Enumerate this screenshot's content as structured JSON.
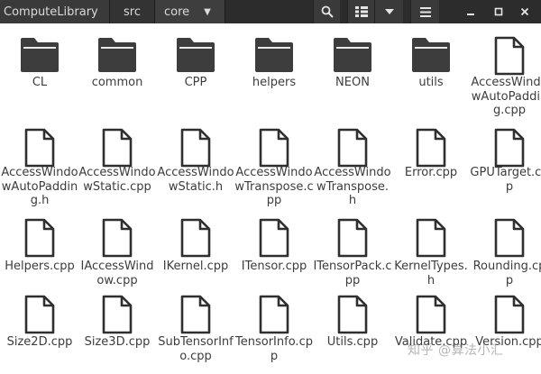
{
  "header": {
    "breadcrumbs": [
      "ComputeLibrary",
      "src",
      "core"
    ],
    "icons": {
      "search": "search-icon",
      "view": "list-view-icon",
      "view_dropdown": "chevron-down-icon",
      "menu": "hamburger-menu-icon",
      "minimize": "minimize-icon",
      "maximize": "maximize-icon",
      "close": "close-icon"
    },
    "colors": {
      "bar": "#2c2c2c",
      "text": "#dadada"
    }
  },
  "items": [
    {
      "name": "CL",
      "type": "folder"
    },
    {
      "name": "common",
      "type": "folder"
    },
    {
      "name": "CPP",
      "type": "folder"
    },
    {
      "name": "helpers",
      "type": "folder"
    },
    {
      "name": "NEON",
      "type": "folder"
    },
    {
      "name": "utils",
      "type": "folder"
    },
    {
      "name": "AccessWindowAutoPadding.cpp",
      "type": "file"
    },
    {
      "name": "AccessWindowAutoPadding.h",
      "type": "file"
    },
    {
      "name": "AccessWindowStatic.cpp",
      "type": "file"
    },
    {
      "name": "AccessWindowStatic.h",
      "type": "file"
    },
    {
      "name": "AccessWindowTranspose.cpp",
      "type": "file"
    },
    {
      "name": "AccessWindowTranspose.h",
      "type": "file"
    },
    {
      "name": "Error.cpp",
      "type": "file"
    },
    {
      "name": "GPUTarget.cpp",
      "type": "file"
    },
    {
      "name": "Helpers.cpp",
      "type": "file"
    },
    {
      "name": "IAccessWindow.cpp",
      "type": "file"
    },
    {
      "name": "IKernel.cpp",
      "type": "file"
    },
    {
      "name": "ITensor.cpp",
      "type": "file"
    },
    {
      "name": "ITensorPack.cpp",
      "type": "file"
    },
    {
      "name": "KernelTypes.h",
      "type": "file"
    },
    {
      "name": "Rounding.cpp",
      "type": "file"
    },
    {
      "name": "Size2D.cpp",
      "type": "file"
    },
    {
      "name": "Size3D.cpp",
      "type": "file"
    },
    {
      "name": "SubTensorInfo.cpp",
      "type": "file"
    },
    {
      "name": "TensorInfo.cpp",
      "type": "file"
    },
    {
      "name": "Utils.cpp",
      "type": "file"
    },
    {
      "name": "Validate.cpp",
      "type": "file"
    },
    {
      "name": "Version.cpp",
      "type": "file"
    }
  ],
  "watermark": "知乎 @算法小汇",
  "colors": {
    "folder": "#3d3d3d",
    "file_outline": "#2f2f2f",
    "label": "#3c3c3c"
  }
}
